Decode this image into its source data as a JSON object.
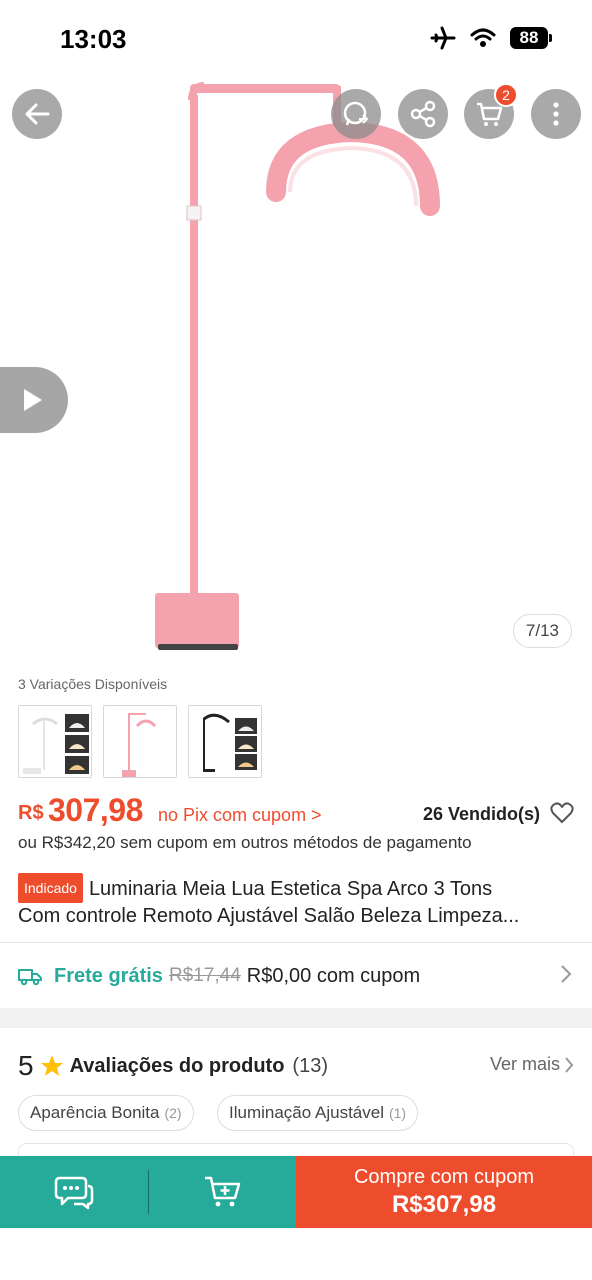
{
  "status_bar": {
    "time": "13:03",
    "battery": "88"
  },
  "hero": {
    "cart_count": "2",
    "image_counter": "7/13",
    "icons": [
      "back-arrow-icon",
      "whatsapp-icon",
      "share-icon",
      "cart-icon",
      "more-vertical-icon",
      "play-icon"
    ]
  },
  "variations": {
    "label": "3 Variações Disponíveis"
  },
  "price": {
    "currency": "R$",
    "value": "307,98",
    "pix_note": "no Pix com cupom >",
    "sold": "26 Vendido(s)",
    "alt_price": "ou R$342,20 sem cupom em outros métodos de pagamento"
  },
  "product": {
    "badge": "Indicado",
    "title_line1": "Luminaria Meia Lua Estetica  Spa Arco 3 Tons",
    "title_line2": "Com controle Remoto Ajustável Salão Beleza  Limpeza..."
  },
  "shipping": {
    "free_label": "Frete grátis",
    "old_price": "R$17,44",
    "new_price": "R$0,00 com cupom"
  },
  "reviews": {
    "rating": "5",
    "title": "Avaliações do produto",
    "count": "(13)",
    "see_more": "Ver mais",
    "tags": [
      {
        "label": "Aparência Bonita",
        "count": "(2)"
      },
      {
        "label": "Iluminação Ajustável",
        "count": "(1)"
      }
    ]
  },
  "bottom_bar": {
    "buy_label": "Compre com cupom",
    "buy_price": "R$307,98"
  },
  "colors": {
    "accent": "#ee4d2d",
    "teal": "#26aa99",
    "product_pink": "#f29aa6"
  }
}
